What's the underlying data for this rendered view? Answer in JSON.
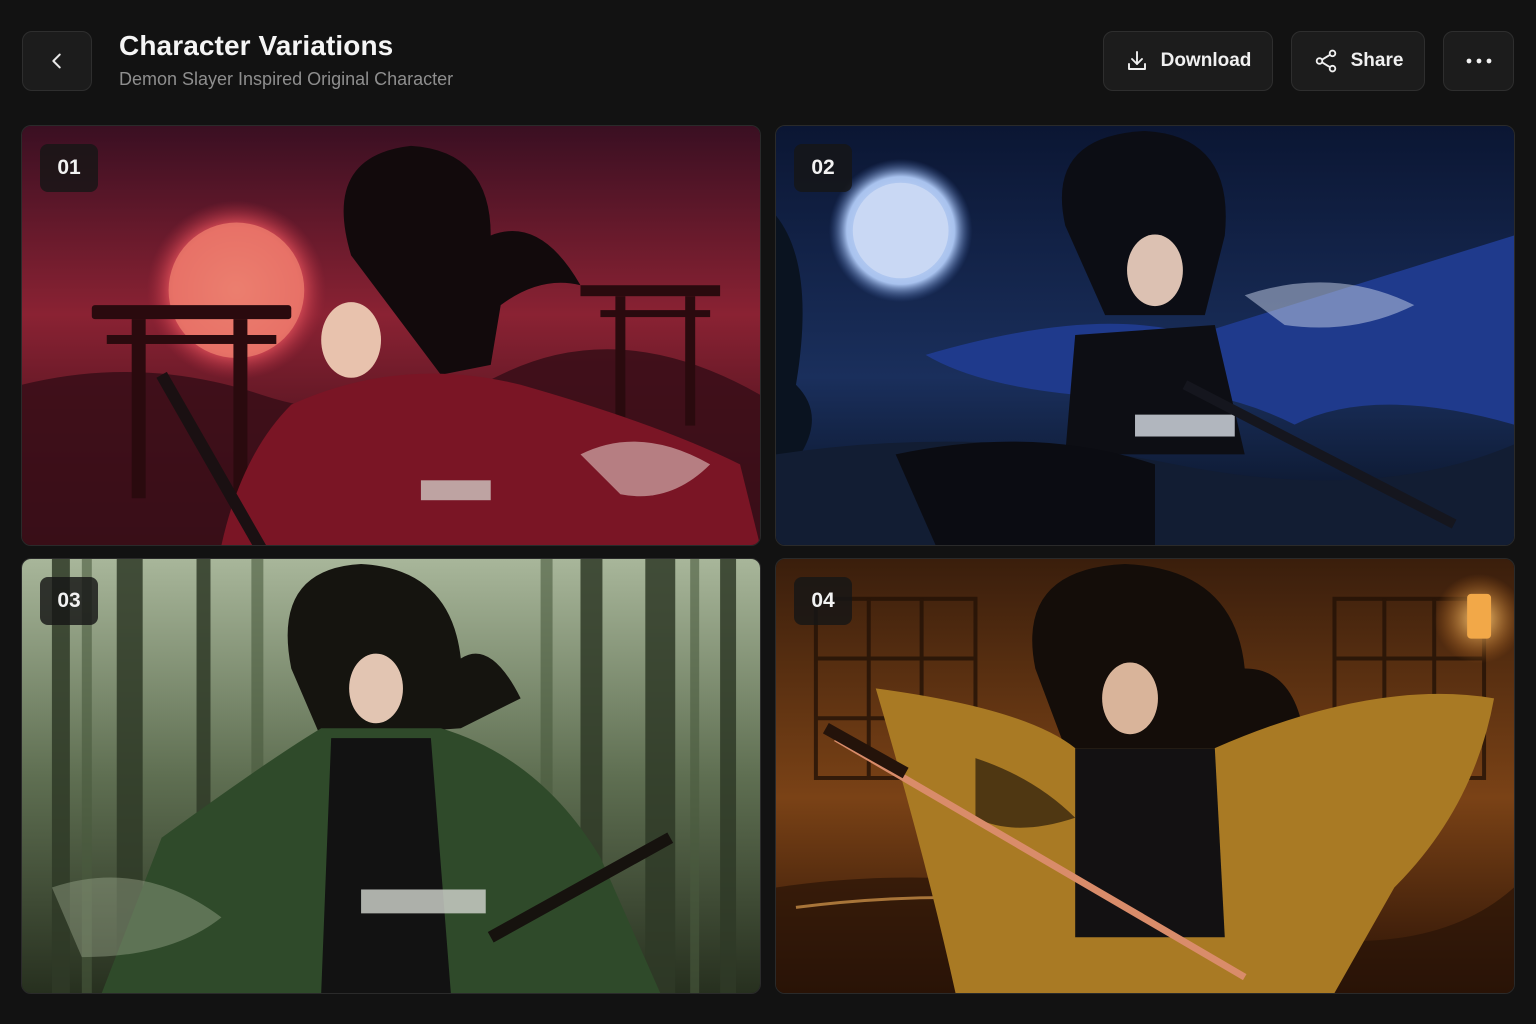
{
  "header": {
    "title": "Character Variations",
    "subtitle": "Demon Slayer Inspired Original Character",
    "back_icon": "chevron-left-icon",
    "download_label": "Download",
    "share_label": "Share",
    "more_icon": "more-horizontal-icon"
  },
  "variations": [
    {
      "badge": "01",
      "scene": "crimson sunset with torii gate",
      "accent": "#b8283a"
    },
    {
      "badge": "02",
      "scene": "moonlit night forest",
      "accent": "#24408c"
    },
    {
      "badge": "03",
      "scene": "misty bamboo forest",
      "accent": "#3f5a38"
    },
    {
      "badge": "04",
      "scene": "lantern-lit dojo with golden glow",
      "accent": "#c98a2c"
    }
  ],
  "colors": {
    "background": "#121212",
    "button_bg": "#1c1c1c",
    "button_border": "#2e2e2e",
    "text_primary": "#f5f5f5",
    "text_secondary": "#8e8e8e"
  }
}
